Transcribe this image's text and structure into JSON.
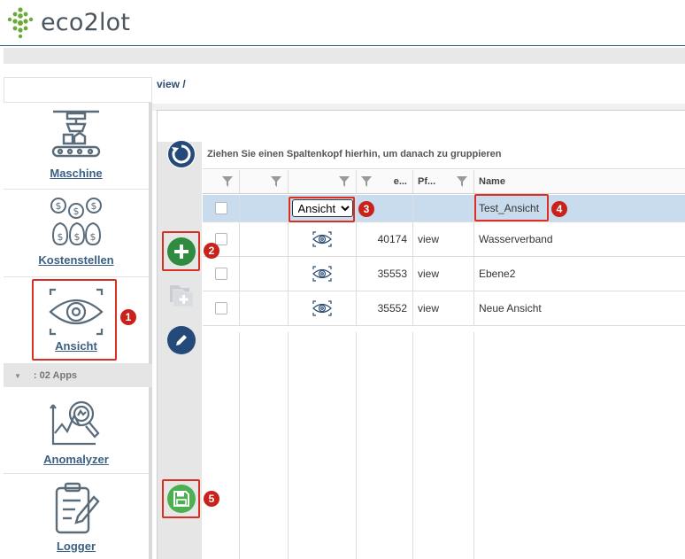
{
  "app": {
    "logo_text": "eco2lot",
    "brand_color": "#6aaa3a",
    "accent_color": "#2d5b8a"
  },
  "breadcrumb": "view /",
  "sidebar": {
    "items": [
      {
        "label": "Maschine",
        "icon": "machine-icon"
      },
      {
        "label": "Kostenstellen",
        "icon": "money-bags-icon"
      },
      {
        "label": "Ansicht",
        "icon": "eye-view-icon"
      },
      {
        "label": "Anomalyzer",
        "icon": "anomaly-chart-icon"
      },
      {
        "label": "Logger",
        "icon": "logger-document-icon"
      }
    ],
    "apps_group": ": 02 Apps"
  },
  "actions": {
    "refresh": "refresh-icon",
    "add": "plus-icon",
    "copy": "copy-icon",
    "edit": "pencil-icon",
    "save": "floppy-icon"
  },
  "grid": {
    "group_hint": "Ziehen Sie einen Spaltenkopf hierhin, um danach zu gruppieren",
    "columns": [
      "",
      "",
      "",
      "e...",
      "Pf...",
      "Name"
    ],
    "new_row": {
      "type_select": "Ansicht",
      "type_options": [
        "Ansicht"
      ],
      "name": "Test_Ansicht"
    },
    "rows": [
      {
        "id": "40174",
        "pf": "view",
        "name": "Wasserverband"
      },
      {
        "id": "35553",
        "pf": "view",
        "name": "Ebene2"
      },
      {
        "id": "35552",
        "pf": "view",
        "name": "Neue Ansicht"
      }
    ]
  },
  "annotations": [
    "1",
    "2",
    "3",
    "4",
    "5"
  ]
}
